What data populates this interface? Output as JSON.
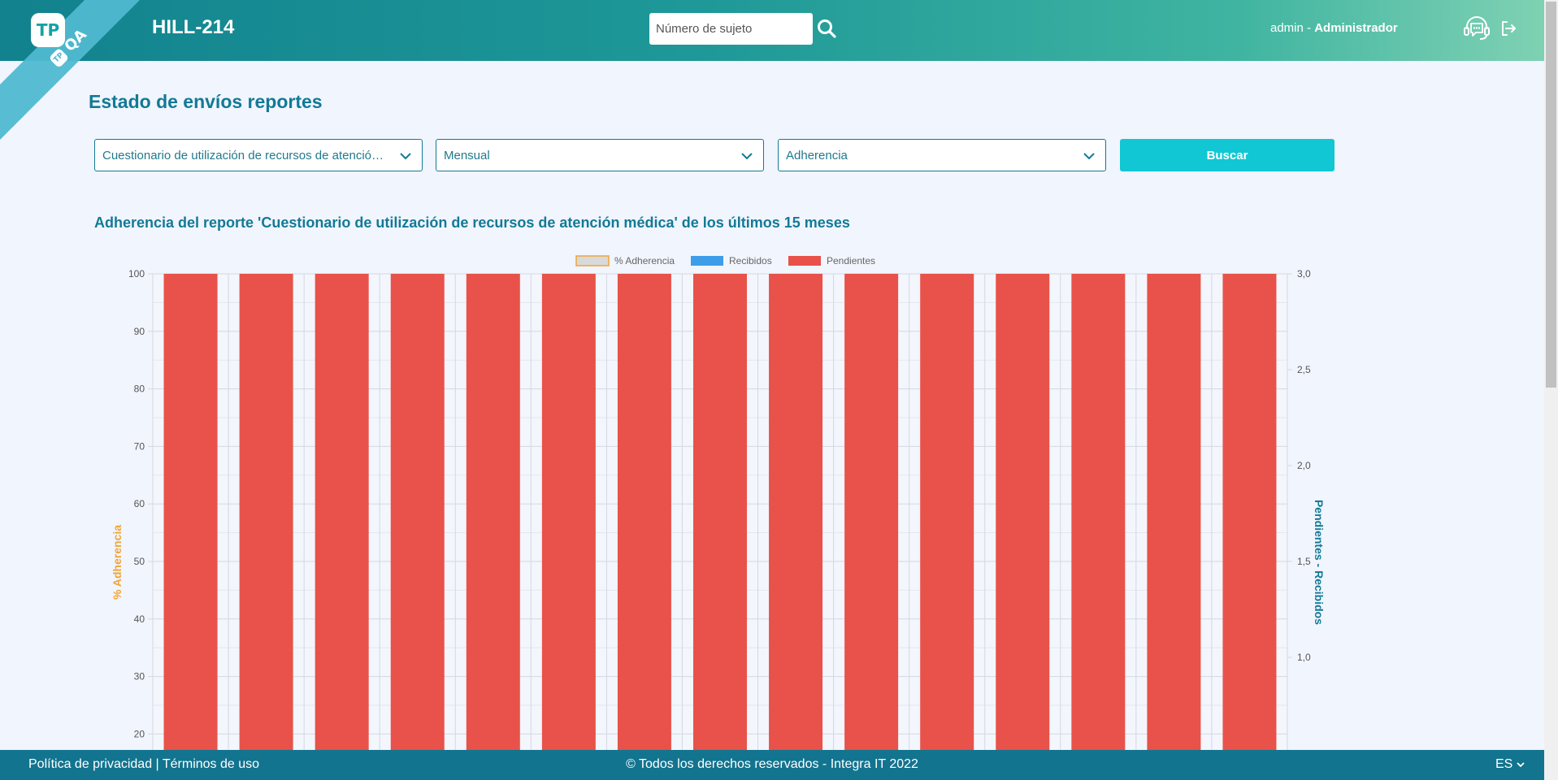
{
  "header": {
    "logo_text": "TP",
    "ribbon_label": "QA",
    "ribbon_logo": "TP",
    "study_code": "HILL-214",
    "subject_placeholder": "Número de sujeto",
    "user_name": "admin",
    "user_separator": " - ",
    "user_role": "Administrador",
    "icons": {
      "search": "search-icon",
      "support": "headset-chat-icon",
      "logout": "logout-icon"
    }
  },
  "main": {
    "page_title": "Estado de envíos reportes",
    "filters": {
      "report_select": "Cuestionario de utilización de recursos de atención médica",
      "period_select": "Mensual",
      "metric_select": "Adherencia",
      "search_label": "Buscar"
    },
    "chart_title": "Adherencia del reporte 'Cuestionario de utilización de recursos de atención médica' de los últimos 15 meses"
  },
  "chart_data": {
    "type": "bar",
    "legend": [
      {
        "name": "% Adherencia",
        "color": "#d9d9d9",
        "border": "#f0a53b"
      },
      {
        "name": "Recibidos",
        "color": "#3d9de8"
      },
      {
        "name": "Pendientes",
        "color": "#e8524a"
      }
    ],
    "legend_position": "top",
    "y_left_label": "% Adherencia",
    "y_right_label": "Pendientes - Recibidos",
    "y_left_ticks": [
      "100",
      "90",
      "80",
      "70",
      "60",
      "50",
      "40",
      "30",
      "20"
    ],
    "y_right_ticks": [
      "3,0",
      "2,5",
      "2,0",
      "1,5",
      "1,0"
    ],
    "ylim_left": [
      0,
      100
    ],
    "ylim_right": [
      0,
      3.0
    ],
    "bar_count": 15,
    "series": [
      {
        "name": "Pendientes",
        "axis": "right",
        "values": [
          3,
          3,
          3,
          3,
          3,
          3,
          3,
          3,
          3,
          3,
          3,
          3,
          3,
          3,
          3
        ]
      },
      {
        "name": "Recibidos",
        "axis": "right",
        "values": [
          0,
          0,
          0,
          0,
          0,
          0,
          0,
          0,
          0,
          0,
          0,
          0,
          0,
          0,
          0
        ]
      },
      {
        "name": "% Adherencia",
        "axis": "left",
        "values": [
          0,
          0,
          0,
          0,
          0,
          0,
          0,
          0,
          0,
          0,
          0,
          0,
          0,
          0,
          0
        ]
      }
    ],
    "grid": true
  },
  "footer": {
    "privacy": "Política de privacidad",
    "separator": " | ",
    "terms": "Términos de uso",
    "copyright": "© Todos los derechos reservados - Integra IT 2022",
    "language": "ES"
  }
}
